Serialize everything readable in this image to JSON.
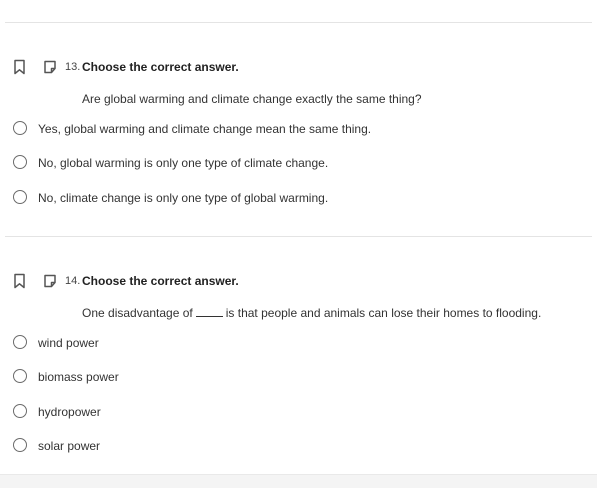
{
  "q13": {
    "number": "13.",
    "title": "Choose the correct answer.",
    "prompt": "Are global warming and climate change exactly the same thing?",
    "options": [
      "Yes, global warming and climate change mean the same thing.",
      "No, global warming is only one type of climate change.",
      "No, climate change is only one type of global warming."
    ]
  },
  "q14": {
    "number": "14.",
    "title": "Choose the correct answer.",
    "prompt_before": "One disadvantage of",
    "prompt_after": "is that people and animals can lose their homes to flooding.",
    "options": [
      "wind power",
      "biomass power",
      "hydropower",
      "solar power"
    ]
  },
  "icons": {
    "bookmark": "bookmark-icon",
    "note": "note-icon"
  }
}
